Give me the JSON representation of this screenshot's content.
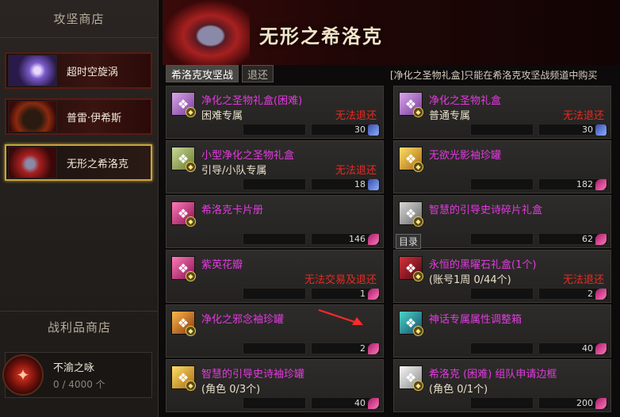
{
  "sidebar": {
    "title": "攻坚商店",
    "raids": [
      {
        "label": "超时空旋涡",
        "active": false
      },
      {
        "label": "普雷·伊希斯",
        "active": false
      },
      {
        "label": "无形之希洛克",
        "active": true
      }
    ],
    "loot_title": "战利品商店",
    "loot": {
      "name": "不渝之咏",
      "count": "0 / 4000 个"
    }
  },
  "header": {
    "title": "无形之希洛克"
  },
  "tabs": [
    {
      "label": "希洛克攻坚战",
      "active": true
    },
    {
      "label": "退还",
      "active": false
    }
  ],
  "notice": "[净化之圣物礼盒]只能在希洛克攻坚战频道中购买",
  "items": [
    {
      "name": "净化之圣物礼盒(困难)",
      "sub": "困难专属",
      "warn": "无法退还",
      "price": "30",
      "currency": "blue",
      "icon": "purple",
      "icon_name": "crest-icon"
    },
    {
      "name": "净化之圣物礼盒",
      "sub": "普通专属",
      "warn": "无法退还",
      "price": "30",
      "currency": "blue",
      "icon": "purple",
      "icon_name": "crest-icon"
    },
    {
      "name": "小型净化之圣物礼盒",
      "sub": "引导/小队专属",
      "warn": "无法退还",
      "price": "18",
      "currency": "blue",
      "icon": "green",
      "icon_name": "crest-small-icon"
    },
    {
      "name": "无欲光影袖珍罐",
      "sub": "",
      "warn": "",
      "price": "182",
      "currency": "pink",
      "icon": "gold",
      "icon_name": "jar-icon"
    },
    {
      "name": "希洛克卡片册",
      "sub": "",
      "warn": "",
      "price": "146",
      "currency": "pink",
      "icon": "pink",
      "icon_name": "card-book-icon"
    },
    {
      "name": "智慧的引导史诗碎片礼盒",
      "sub": "",
      "warn": "",
      "price": "62",
      "currency": "pink",
      "icon": "gray",
      "icon_name": "gift-box-icon",
      "tag": "目录"
    },
    {
      "name": "紫英花瓣",
      "sub": "",
      "warn": "无法交易及退还",
      "price": "1",
      "currency": "pink",
      "icon": "pink",
      "icon_name": "petal-icon"
    },
    {
      "name": "永恒的黑曜石礼盒(1个)",
      "sub": "(账号1周 0/44个)",
      "warn": "无法退还",
      "price": "2",
      "currency": "pink",
      "icon": "red",
      "icon_name": "obsidian-box-icon"
    },
    {
      "name": "净化之邪念袖珍罐",
      "sub": "",
      "warn": "",
      "price": "2",
      "currency": "pink",
      "icon": "orange",
      "icon_name": "evil-jar-icon"
    },
    {
      "name": "神话专属属性调整箱",
      "sub": "",
      "warn": "",
      "price": "40",
      "currency": "pink",
      "icon": "teal",
      "icon_name": "mythic-chest-icon"
    },
    {
      "name": "智慧的引导史诗袖珍罐",
      "sub": "(角色 0/3个)",
      "warn": "",
      "price": "40",
      "currency": "pink",
      "icon": "gold",
      "icon_name": "epic-jar-icon"
    },
    {
      "name": "希洛克 (困难) 组队申请边框",
      "sub": "(角色 0/1个)",
      "warn": "",
      "price": "200",
      "currency": "pink",
      "icon": "doc",
      "icon_name": "frame-scroll-icon"
    }
  ]
}
